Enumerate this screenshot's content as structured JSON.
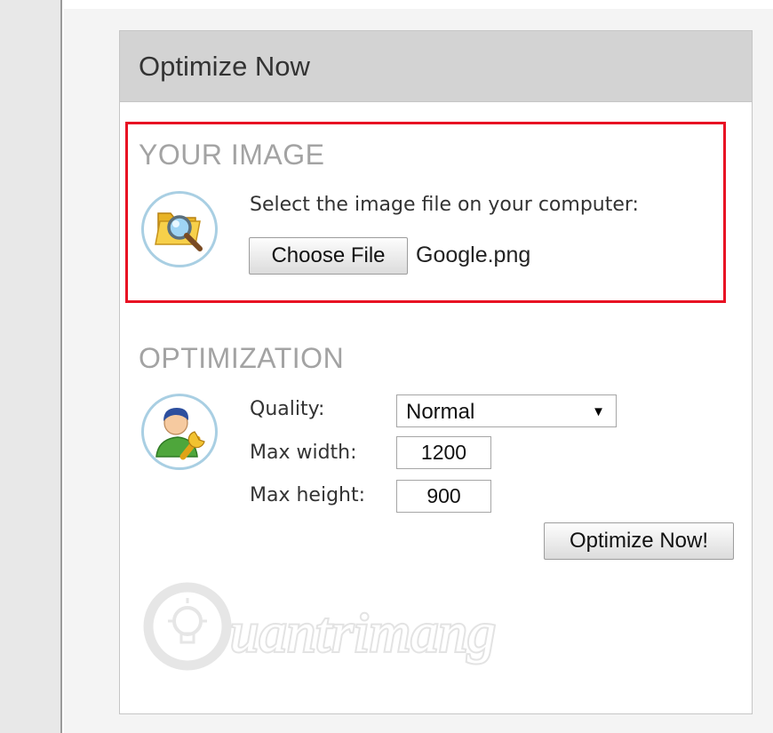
{
  "panel": {
    "title": "Optimize Now"
  },
  "image_section": {
    "heading": "YOUR IMAGE",
    "icon": "folder-search-icon",
    "prompt": "Select the image file on your computer:",
    "choose_button": "Choose File",
    "file_name": "Google.png",
    "highlight_color": "#e81123"
  },
  "optimization": {
    "heading": "OPTIMIZATION",
    "icon": "user-wrench-icon",
    "quality_label": "Quality:",
    "quality_value": "Normal",
    "quality_arrow": "▼",
    "max_width_label": "Max width:",
    "max_width_value": "1200",
    "max_height_label": "Max height:",
    "max_height_value": "900",
    "submit_button": "Optimize Now!"
  },
  "watermark": {
    "text": "uantrimang",
    "icon": "lightbulb-icon"
  }
}
